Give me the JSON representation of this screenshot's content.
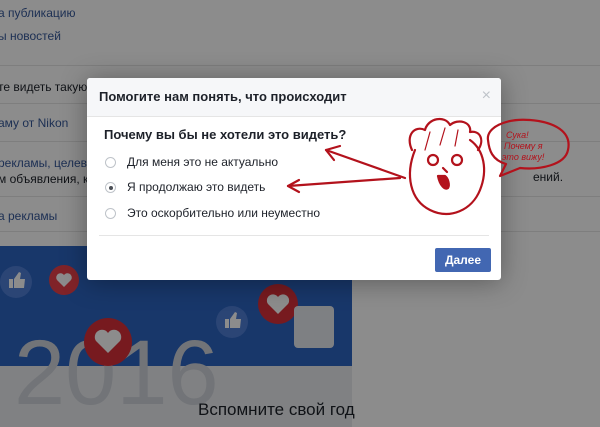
{
  "background": {
    "links": [
      "а публикацию",
      "ы новостей",
      "те видеть такую р",
      "аму от Nikon",
      "рекламы, целева",
      "м объявления, кот",
      "а рекламы"
    ],
    "right_text": "ений.",
    "memory_caption": "Вспомните свой год",
    "banner_year": "2016"
  },
  "dialog": {
    "title": "Помогите нам понять, что происходит",
    "close_label": "×",
    "question": "Почему вы бы не хотели это видеть?",
    "options": [
      {
        "label": "Для меня это не актуально",
        "checked": false
      },
      {
        "label": "Я продолжаю это видеть",
        "checked": true
      },
      {
        "label": "Это оскорбительно или неуместно",
        "checked": false
      }
    ],
    "next_label": "Далее"
  },
  "annotation": {
    "speech_text": "Сука! Почему я это вижу!",
    "color": "#b3121c"
  },
  "colors": {
    "link": "#365899",
    "primary_button": "#4267b2",
    "banner_blue": "#2d64c2"
  }
}
